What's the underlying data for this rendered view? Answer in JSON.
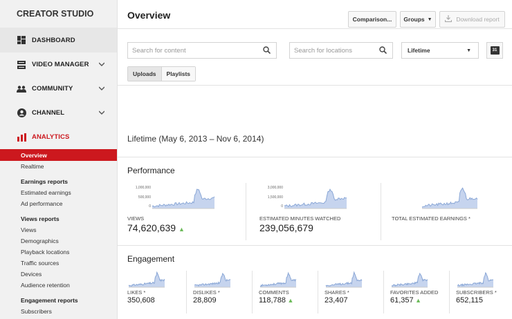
{
  "sidebar": {
    "brand": "CREATOR STUDIO",
    "nav": {
      "dashboard": "DASHBOARD",
      "video_manager": "VIDEO MANAGER",
      "community": "COMMUNITY",
      "channel": "CHANNEL",
      "analytics": "ANALYTICS"
    },
    "analytics_items": {
      "overview": "Overview",
      "realtime": "Realtime",
      "earnings_head": "Earnings reports",
      "estimated_earnings": "Estimated earnings",
      "ad_performance": "Ad performance",
      "views_head": "Views reports",
      "views": "Views",
      "demographics": "Demographics",
      "playback_locations": "Playback locations",
      "traffic_sources": "Traffic sources",
      "devices": "Devices",
      "audience_retention": "Audience retention",
      "engagement_head": "Engagement reports",
      "subscribers": "Subscribers"
    },
    "active_color": "#cc181e"
  },
  "header": {
    "title": "Overview",
    "comparison_label": "Comparison...",
    "groups_label": "Groups",
    "download_label": "Download report"
  },
  "filters": {
    "content_placeholder": "Search for content",
    "locations_placeholder": "Search for locations",
    "period_value": "Lifetime",
    "calendar_day": "31",
    "tabs": [
      "Uploads",
      "Playlists"
    ]
  },
  "range_text": "Lifetime (May 6, 2013 – Nov 6, 2014)",
  "performance": {
    "title": "Performance",
    "views": {
      "label": "VIEWS",
      "value": "74,620,639",
      "axis": [
        "1,000,000",
        "500,000",
        "0"
      ]
    },
    "minutes": {
      "label": "ESTIMATED MINUTES WATCHED",
      "value": "239,056,679",
      "axis": [
        "3,000,000",
        "1,500,000",
        "0"
      ]
    },
    "earnings": {
      "label": "TOTAL ESTIMATED EARNINGS *"
    }
  },
  "engagement": {
    "title": "Engagement",
    "metrics": [
      {
        "label": "LIKES *",
        "value": "350,608",
        "trend_up": false
      },
      {
        "label": "DISLIKES *",
        "value": "28,809",
        "trend_up": false
      },
      {
        "label": "COMMENTS",
        "value": "118,788",
        "trend_up": true
      },
      {
        "label": "SHARES *",
        "value": "23,407",
        "trend_up": false
      },
      {
        "label": "FAVORITES ADDED",
        "value": "61,357",
        "trend_up": true
      },
      {
        "label": "SUBSCRIBERS *",
        "value": "652,115",
        "trend_up": false
      }
    ]
  },
  "colors": {
    "spark": "#8aa7d6",
    "up_arrow": "#6dbb5a",
    "accent": "#cc181e"
  }
}
